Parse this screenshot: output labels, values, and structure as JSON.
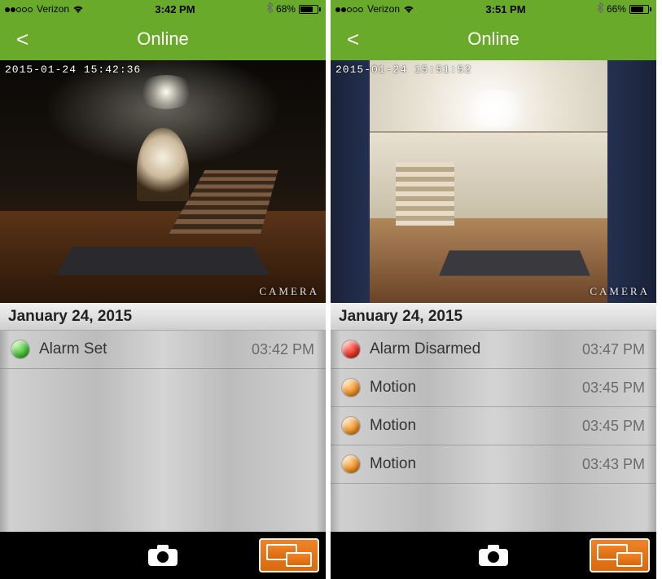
{
  "screens": [
    {
      "status": {
        "carrier": "Verizon",
        "time": "3:42 PM",
        "battery_pct": "68%",
        "battery_fill": 68
      },
      "nav": {
        "title": "Online",
        "back": "<"
      },
      "video": {
        "timestamp": "2015-01-24 15:42:36",
        "label": "CAMERA",
        "scene": "dark"
      },
      "date_header": "January 24, 2015",
      "events": [
        {
          "color": "#4ac23a",
          "label": "Alarm Set",
          "time": "03:42 PM"
        }
      ]
    },
    {
      "status": {
        "carrier": "Verizon",
        "time": "3:51 PM",
        "battery_pct": "66%",
        "battery_fill": 66
      },
      "nav": {
        "title": "Online",
        "back": "<"
      },
      "video": {
        "timestamp": "2015-01-24 15:51:52",
        "label": "CAMERA",
        "scene": "bright"
      },
      "date_header": "January 24, 2015",
      "events": [
        {
          "color": "#e8362a",
          "label": "Alarm Disarmed",
          "time": "03:47 PM"
        },
        {
          "color": "#f0942a",
          "label": "Motion",
          "time": "03:45 PM"
        },
        {
          "color": "#f0942a",
          "label": "Motion",
          "time": "03:45 PM"
        },
        {
          "color": "#f0942a",
          "label": "Motion",
          "time": "03:43 PM"
        }
      ]
    }
  ]
}
